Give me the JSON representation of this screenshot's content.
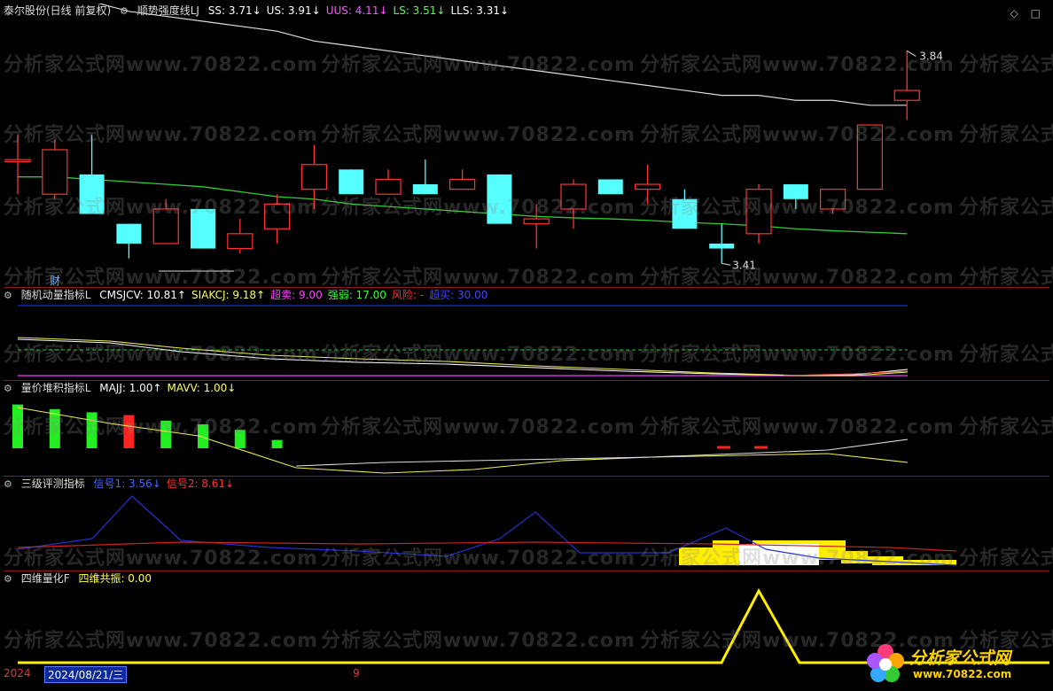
{
  "main": {
    "title": "泰尔股份(日线 前复权)",
    "indicator": "顺势强度线LJ",
    "items": [
      {
        "label": "SS: 3.71↓",
        "color": "#ffffff"
      },
      {
        "label": "US: 3.91↓",
        "color": "#ffffff"
      },
      {
        "label": "UUS: 4.11↓",
        "color": "#ff55ff"
      },
      {
        "label": "LS: 3.51↓",
        "color": "#55ff55"
      },
      {
        "label": "LLS: 3.31↓",
        "color": "#ffffff"
      }
    ],
    "high_label": "3.84",
    "low_label": "3.41",
    "cai_label": "财"
  },
  "p2": {
    "name": "随机动量指标L",
    "items": [
      {
        "label": "CMSJCV: 10.81↑",
        "color": "#ffffff"
      },
      {
        "label": "SIAKCJ: 9.18↑",
        "color": "#ffff66"
      },
      {
        "label": "超卖: 9.00",
        "color": "#ff44ff"
      },
      {
        "label": "强弱: 17.00",
        "color": "#33ff33"
      },
      {
        "label": "风险: -",
        "color": "#ff3333"
      },
      {
        "label": "超买: 30.00",
        "color": "#4444ff"
      }
    ]
  },
  "p3": {
    "name": "量价堆积指标L",
    "items": [
      {
        "label": "MAJJ: 1.00↑",
        "color": "#ffffff"
      },
      {
        "label": "MAVV: 1.00↓",
        "color": "#ffff66"
      }
    ]
  },
  "p4": {
    "name": "三级评测指标",
    "items": [
      {
        "label": "信号1: 3.56↓",
        "color": "#4466ff"
      },
      {
        "label": "信号2: 8.61↓",
        "color": "#ff3333"
      }
    ]
  },
  "p5": {
    "name": "四维量化F",
    "items": [
      {
        "label": "四维共振: 0.00",
        "color": "#ffff44"
      }
    ]
  },
  "status": {
    "year": "2024",
    "date": "2024/08/21/三",
    "num": "9"
  },
  "watermark": "分析家公式网www.70822.com",
  "logo": {
    "name": "分析家公式网",
    "url": "www.70822.com"
  },
  "colors": {
    "up": "#ff3333",
    "down": "#55ffff",
    "ma": "#33cc33",
    "border": "#8b1a1a"
  },
  "candles": [
    {
      "o": 3.62,
      "c": 3.62,
      "h": 3.67,
      "l": 3.55
    },
    {
      "o": 3.55,
      "c": 3.64,
      "h": 3.66,
      "l": 3.54
    },
    {
      "o": 3.59,
      "c": 3.51,
      "h": 3.67,
      "l": 3.51
    },
    {
      "o": 3.49,
      "c": 3.45,
      "h": 3.49,
      "l": 3.42
    },
    {
      "o": 3.45,
      "c": 3.52,
      "h": 3.54,
      "l": 3.45
    },
    {
      "o": 3.52,
      "c": 3.44,
      "h": 3.52,
      "l": 3.44
    },
    {
      "o": 3.44,
      "c": 3.47,
      "h": 3.5,
      "l": 3.43
    },
    {
      "o": 3.48,
      "c": 3.53,
      "h": 3.55,
      "l": 3.45
    },
    {
      "o": 3.56,
      "c": 3.61,
      "h": 3.65,
      "l": 3.52
    },
    {
      "o": 3.6,
      "c": 3.55,
      "h": 3.6,
      "l": 3.55
    },
    {
      "o": 3.55,
      "c": 3.58,
      "h": 3.6,
      "l": 3.55
    },
    {
      "o": 3.57,
      "c": 3.55,
      "h": 3.62,
      "l": 3.55
    },
    {
      "o": 3.56,
      "c": 3.58,
      "h": 3.6,
      "l": 3.56
    },
    {
      "o": 3.59,
      "c": 3.49,
      "h": 3.59,
      "l": 3.49
    },
    {
      "o": 3.49,
      "c": 3.5,
      "h": 3.53,
      "l": 3.44
    },
    {
      "o": 3.52,
      "c": 3.57,
      "h": 3.58,
      "l": 3.48
    },
    {
      "o": 3.58,
      "c": 3.55,
      "h": 3.58,
      "l": 3.55
    },
    {
      "o": 3.56,
      "c": 3.57,
      "h": 3.61,
      "l": 3.53
    },
    {
      "o": 3.54,
      "c": 3.48,
      "h": 3.56,
      "l": 3.48
    },
    {
      "o": 3.45,
      "c": 3.44,
      "h": 3.49,
      "l": 3.41
    },
    {
      "o": 3.47,
      "c": 3.56,
      "h": 3.57,
      "l": 3.45
    },
    {
      "o": 3.57,
      "c": 3.54,
      "h": 3.57,
      "l": 3.52
    },
    {
      "o": 3.52,
      "c": 3.56,
      "h": 3.56,
      "l": 3.51
    },
    {
      "o": 3.56,
      "c": 3.69,
      "h": 3.69,
      "l": 3.56
    },
    {
      "o": 3.74,
      "c": 3.76,
      "h": 3.84,
      "l": 3.7
    }
  ],
  "ma_line": [
    3.585,
    3.585,
    3.58,
    3.575,
    3.57,
    3.565,
    3.555,
    3.545,
    3.54,
    3.53,
    3.525,
    3.52,
    3.515,
    3.51,
    3.505,
    3.502,
    3.5,
    3.497,
    3.493,
    3.49,
    3.486,
    3.48,
    3.476,
    3.473,
    3.47
  ],
  "white_line": [
    3.91,
    3.9,
    3.89,
    3.87,
    3.86,
    3.85,
    3.84,
    3.83,
    3.81,
    3.8,
    3.79,
    3.78,
    3.77,
    3.76,
    3.75,
    3.74,
    3.73,
    3.72,
    3.71,
    3.7,
    3.7,
    3.69,
    3.69,
    3.68,
    3.68
  ],
  "vol_bars": [
    {
      "v": 0.95,
      "c": "#22ee22"
    },
    {
      "v": 0.85,
      "c": "#22ee22"
    },
    {
      "v": 0.78,
      "c": "#22ee22"
    },
    {
      "v": 0.72,
      "c": "#ff2222"
    },
    {
      "v": 0.6,
      "c": "#22ee22"
    },
    {
      "v": 0.52,
      "c": "#22ee22"
    },
    {
      "v": 0.4,
      "c": "#22ee22"
    },
    {
      "v": 0.18,
      "c": "#22ee22"
    }
  ]
}
